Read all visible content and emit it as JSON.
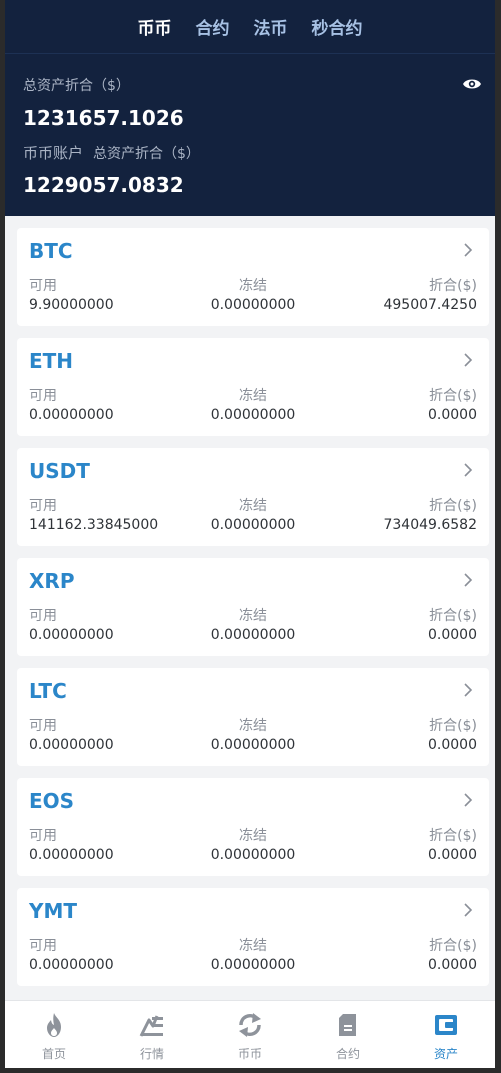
{
  "tabs": [
    "币币",
    "合约",
    "法币",
    "秒合约"
  ],
  "active_tab": 0,
  "summary": {
    "total_label": "总资产折合（$）",
    "total_value": "1231657.1026",
    "account_name": "币币账户",
    "account_sub_label": "总资产折合（$）",
    "account_value": "1229057.0832"
  },
  "columns": {
    "available": "可用",
    "frozen": "冻结",
    "converted": "折合($)"
  },
  "assets": [
    {
      "coin": "BTC",
      "available": "9.90000000",
      "frozen": "0.00000000",
      "converted": "495007.4250"
    },
    {
      "coin": "ETH",
      "available": "0.00000000",
      "frozen": "0.00000000",
      "converted": "0.0000"
    },
    {
      "coin": "USDT",
      "available": "141162.33845000",
      "frozen": "0.00000000",
      "converted": "734049.6582"
    },
    {
      "coin": "XRP",
      "available": "0.00000000",
      "frozen": "0.00000000",
      "converted": "0.0000"
    },
    {
      "coin": "LTC",
      "available": "0.00000000",
      "frozen": "0.00000000",
      "converted": "0.0000"
    },
    {
      "coin": "EOS",
      "available": "0.00000000",
      "frozen": "0.00000000",
      "converted": "0.0000"
    },
    {
      "coin": "YMT",
      "available": "0.00000000",
      "frozen": "0.00000000",
      "converted": "0.0000"
    }
  ],
  "nav": [
    {
      "label": "首页",
      "icon": "fire-icon"
    },
    {
      "label": "行情",
      "icon": "market-icon"
    },
    {
      "label": "币币",
      "icon": "exchange-icon"
    },
    {
      "label": "合约",
      "icon": "contract-icon"
    },
    {
      "label": "资产",
      "icon": "wallet-icon"
    }
  ],
  "active_nav": 4,
  "colors": {
    "header_bg": "#13223e",
    "accent": "#2b86c9",
    "nav_icon": "#8e939b"
  }
}
